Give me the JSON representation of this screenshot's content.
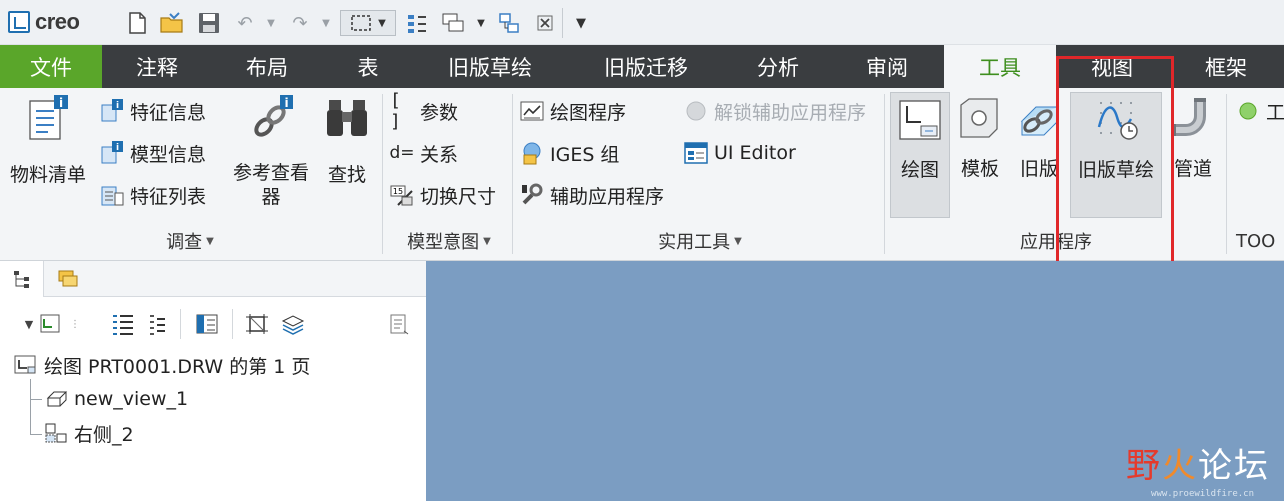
{
  "app": {
    "logo_text": "creo"
  },
  "quick_access": {
    "icons": [
      "new-file-icon",
      "open-folder-icon",
      "save-icon",
      "undo-icon",
      "redo-icon",
      "select-box-icon",
      "regenerate-icon",
      "windows-icon",
      "pipeline-icon",
      "close-window-icon",
      "customize-icon"
    ]
  },
  "tabs": [
    {
      "label": "文件"
    },
    {
      "label": "注释"
    },
    {
      "label": "布局"
    },
    {
      "label": "表"
    },
    {
      "label": "旧版草绘"
    },
    {
      "label": "旧版迁移"
    },
    {
      "label": "分析"
    },
    {
      "label": "审阅"
    },
    {
      "label": "工具"
    },
    {
      "label": "视图"
    },
    {
      "label": "框架"
    }
  ],
  "ribbon": {
    "investigate": {
      "bom": "物料清单",
      "feature_info": "特征信息",
      "model_info": "模型信息",
      "feature_list": "特征列表",
      "ref_viewer": "参考查看",
      "ref_viewer_2": "器",
      "find": "查找",
      "label": "调查"
    },
    "model_intent": {
      "params": "参数",
      "relations": "关系",
      "switch_dims": "切换尺寸",
      "label": "模型意图"
    },
    "utilities": {
      "drawing_program": "绘图程序",
      "unlock_aux": "解锁辅助应用程序",
      "iges": "IGES 组",
      "ui_editor": "UI Editor",
      "aux_apps": "辅助应用程序",
      "label": "实用工具"
    },
    "applications": {
      "drawing": "绘图",
      "template": "模板",
      "legacy": "旧版",
      "legacy_sketch": "旧版草绘",
      "piping": "管道",
      "label": "应用程序"
    },
    "tools_partial": {
      "label": "TOO",
      "item": "工"
    }
  },
  "tree": {
    "root": "绘图 PRT0001.DRW 的第 1 页",
    "items": [
      "new_view_1",
      "右侧_2"
    ]
  },
  "watermark": {
    "main": "野",
    "main2": "火",
    "main3": "论坛",
    "url": "www.proewildfire.cn"
  },
  "colors": {
    "file_tab": "#5aa62a",
    "active_tab_text": "#3e8e1e",
    "canvas": "#7b9dc2",
    "highlight": "#e0272a"
  }
}
